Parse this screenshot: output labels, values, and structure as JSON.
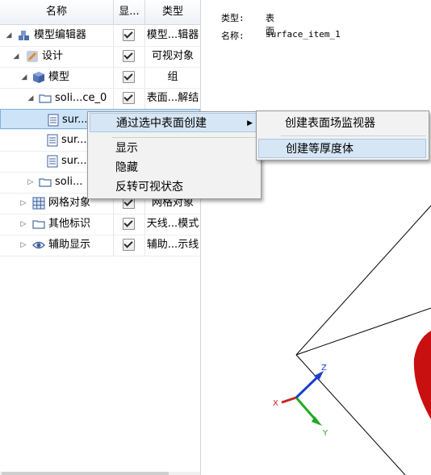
{
  "tree_header": {
    "col_name": "名称",
    "col_visible": "显...",
    "col_type": "类型"
  },
  "rows": [
    {
      "name": "模型编辑器",
      "type": "模型...辑器"
    },
    {
      "name": "设计",
      "type": "可视对象"
    },
    {
      "name": "模型",
      "type": "组"
    },
    {
      "name": "soli...ce_0",
      "type": "表面...解结"
    },
    {
      "name": "sur...",
      "type": ""
    },
    {
      "name": "sur...",
      "type": ""
    },
    {
      "name": "sur...",
      "type": ""
    },
    {
      "name": "soli...",
      "type": ""
    },
    {
      "name": "网格对象",
      "type": "网格对象"
    },
    {
      "name": "其他标识",
      "type": "天线...模式"
    },
    {
      "name": "辅助显示",
      "type": "辅助...示线"
    }
  ],
  "info": {
    "type_label": "类型:",
    "type_value": "表面",
    "name_label": "名称:",
    "name_value": "surface_item_1"
  },
  "context_menu": {
    "create_from_surface": "通过选中表面创建",
    "show": "显示",
    "hide": "隐藏",
    "invert_visibility": "反转可视状态"
  },
  "submenu": {
    "create_monitor": "创建表面场监视器",
    "create_thickness": "创建等厚度体"
  },
  "axes": {
    "x": "X",
    "y": "Y",
    "z": "Z"
  },
  "colors": {
    "selection": "#cde3f7",
    "red_object": "#c81010"
  }
}
